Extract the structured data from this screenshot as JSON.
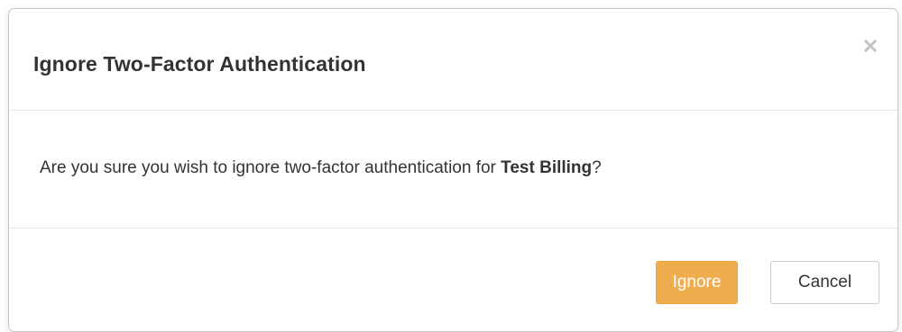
{
  "dialog": {
    "title": "Ignore Two-Factor Authentication",
    "close_icon": "close-icon",
    "message_prefix": "Are you sure you wish to ignore two-factor authentication for ",
    "account_name": "Test Billing",
    "message_suffix": "?",
    "ignore_label": "Ignore",
    "cancel_label": "Cancel"
  },
  "colors": {
    "ignore_button": "#f0ad4e",
    "ignore_text": "#ffffff",
    "cancel_button": "#ffffff",
    "title_text": "#333333",
    "close_icon": "#c4c4c4"
  }
}
